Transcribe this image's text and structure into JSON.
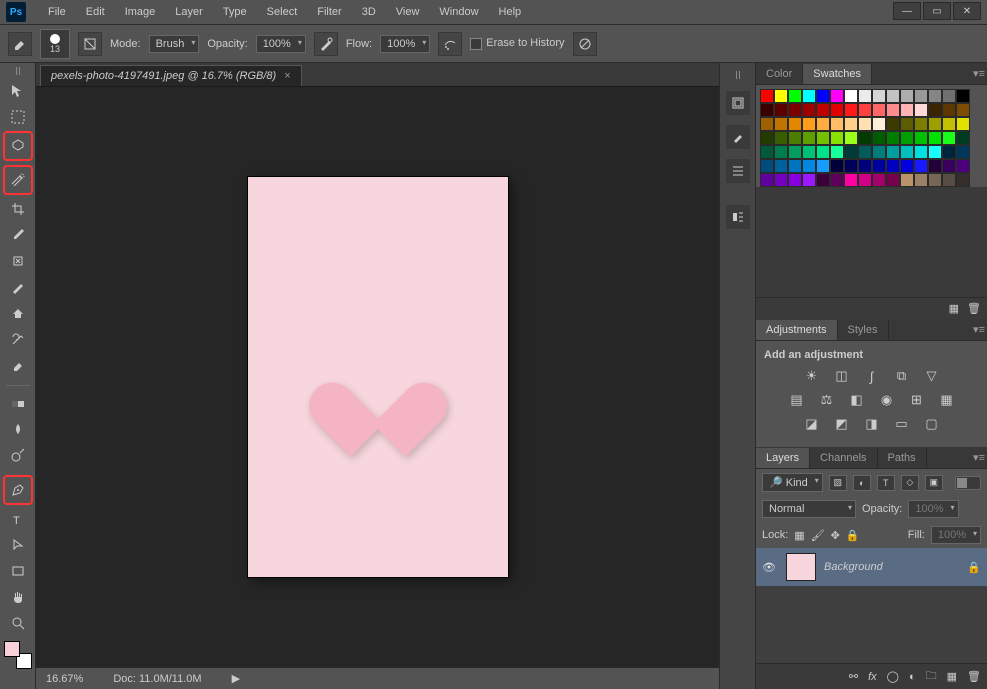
{
  "menu": [
    "File",
    "Edit",
    "Image",
    "Layer",
    "Type",
    "Select",
    "Filter",
    "3D",
    "View",
    "Window",
    "Help"
  ],
  "options": {
    "brush_size": "13",
    "mode_label": "Mode:",
    "mode_value": "Brush",
    "opacity_label": "Opacity:",
    "opacity_value": "100%",
    "flow_label": "Flow:",
    "flow_value": "100%",
    "erase_label": "Erase to History"
  },
  "document": {
    "tab_title": "pexels-photo-4197491.jpeg @ 16.7% (RGB/8)"
  },
  "status": {
    "zoom": "16.67%",
    "doc_info": "Doc: 11.0M/11.0M"
  },
  "panels": {
    "color_tab": "Color",
    "swatches_tab": "Swatches",
    "adjustments_tab": "Adjustments",
    "styles_tab": "Styles",
    "adjust_hint": "Add an adjustment",
    "layers_tab": "Layers",
    "channels_tab": "Channels",
    "paths_tab": "Paths"
  },
  "layers": {
    "kind_label": "Kind",
    "blend_mode": "Normal",
    "opacity_label": "Opacity:",
    "opacity_value": "100%",
    "lock_label": "Lock:",
    "fill_label": "Fill:",
    "fill_value": "100%",
    "bg_name": "Background"
  },
  "swatches": [
    "#ff0000",
    "#ffff00",
    "#00ff00",
    "#00ffff",
    "#0000ff",
    "#ff00ff",
    "#ffffff",
    "#ebebeb",
    "#d6d6d6",
    "#c2c2c2",
    "#adadad",
    "#999999",
    "#858585",
    "#707070",
    "#000000",
    "#3b0000",
    "#5c0000",
    "#7d0000",
    "#9e0000",
    "#c00000",
    "#e10000",
    "#ff1919",
    "#ff4040",
    "#ff6666",
    "#ff8c8c",
    "#ffb3b3",
    "#ffd9d9",
    "#3b2400",
    "#5c3800",
    "#7d4c00",
    "#9e6000",
    "#c07400",
    "#e18800",
    "#ff9c19",
    "#ffad40",
    "#ffbe66",
    "#ffcf8c",
    "#ffe0b3",
    "#fff1d9",
    "#3b3b00",
    "#5c5c00",
    "#7d7d00",
    "#9e9e00",
    "#c0c000",
    "#e1e100",
    "#243b00",
    "#385c00",
    "#4c7d00",
    "#609e00",
    "#74c000",
    "#88e100",
    "#9cff19",
    "#003b00",
    "#005c00",
    "#007d00",
    "#009e00",
    "#00c000",
    "#00e100",
    "#19ff19",
    "#003b24",
    "#005c38",
    "#007d4c",
    "#009e60",
    "#00c074",
    "#00e188",
    "#19ff9c",
    "#003b3b",
    "#005c5c",
    "#007d7d",
    "#009e9e",
    "#00c0c0",
    "#00e1e1",
    "#19ffff",
    "#00243b",
    "#00385c",
    "#004c7d",
    "#00609e",
    "#0074c0",
    "#0088e1",
    "#199cff",
    "#00003b",
    "#00005c",
    "#00007d",
    "#00009e",
    "#0000c0",
    "#0000e1",
    "#1919ff",
    "#24003b",
    "#38005c",
    "#4c007d",
    "#60009e",
    "#7400c0",
    "#8800e1",
    "#9c19ff",
    "#3b003b",
    "#5c005c",
    "#ff00a2",
    "#d10086",
    "#a3006a",
    "#75004e",
    "#ba936b",
    "#998066",
    "#786655",
    "#574c44",
    "#362d2d",
    "#aa8855",
    "#cc9966",
    "#ddaa77",
    "#eebb88",
    "#665544",
    "#443322"
  ]
}
